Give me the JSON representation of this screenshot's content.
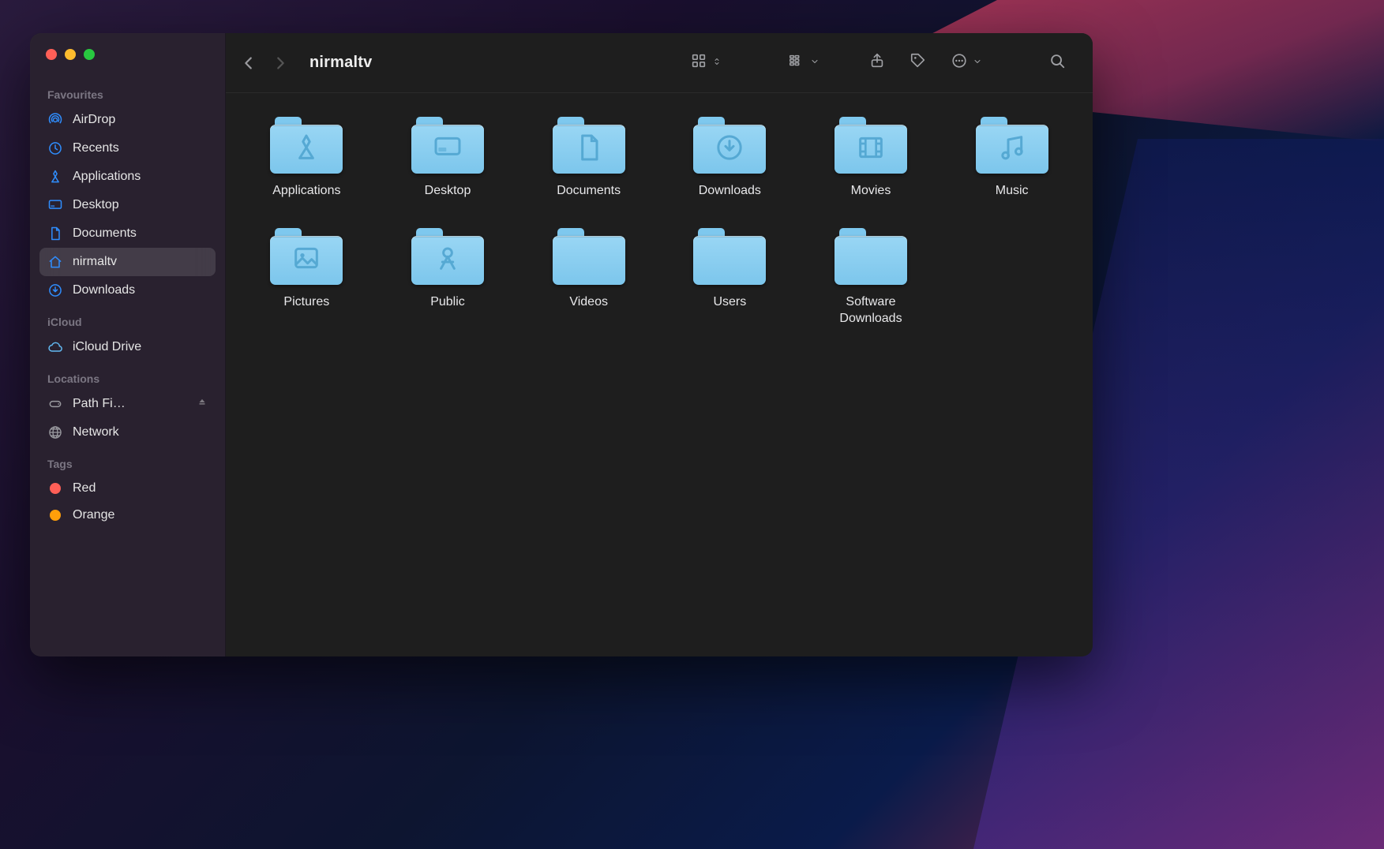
{
  "window": {
    "title": "nirmaltv"
  },
  "sidebar": {
    "sections": [
      {
        "title": "Favourites",
        "items": [
          {
            "icon": "airdrop",
            "label": "AirDrop"
          },
          {
            "icon": "clock",
            "label": "Recents"
          },
          {
            "icon": "apps",
            "label": "Applications"
          },
          {
            "icon": "desktop",
            "label": "Desktop"
          },
          {
            "icon": "doc",
            "label": "Documents"
          },
          {
            "icon": "home",
            "label": "nirmaltv",
            "active": true
          },
          {
            "icon": "download",
            "label": "Downloads"
          }
        ]
      },
      {
        "title": "iCloud",
        "items": [
          {
            "icon": "cloud",
            "label": "iCloud Drive"
          }
        ]
      },
      {
        "title": "Locations",
        "items": [
          {
            "icon": "disk",
            "label": "Path Fi…",
            "eject": true
          },
          {
            "icon": "globe",
            "label": "Network"
          }
        ]
      },
      {
        "title": "Tags",
        "items": [
          {
            "icon": "tag-red",
            "label": "Red"
          },
          {
            "icon": "tag-orange",
            "label": "Orange"
          }
        ]
      }
    ]
  },
  "folders": [
    {
      "name": "Applications",
      "glyph": "apps"
    },
    {
      "name": "Desktop",
      "glyph": "desktop"
    },
    {
      "name": "Documents",
      "glyph": "doc"
    },
    {
      "name": "Downloads",
      "glyph": "download"
    },
    {
      "name": "Movies",
      "glyph": "movie"
    },
    {
      "name": "Music",
      "glyph": "music"
    },
    {
      "name": "Pictures",
      "glyph": "picture"
    },
    {
      "name": "Public",
      "glyph": "public"
    },
    {
      "name": "Videos",
      "glyph": "blank"
    },
    {
      "name": "Users",
      "glyph": "blank"
    },
    {
      "name": "Software Downloads",
      "glyph": "blank"
    }
  ]
}
